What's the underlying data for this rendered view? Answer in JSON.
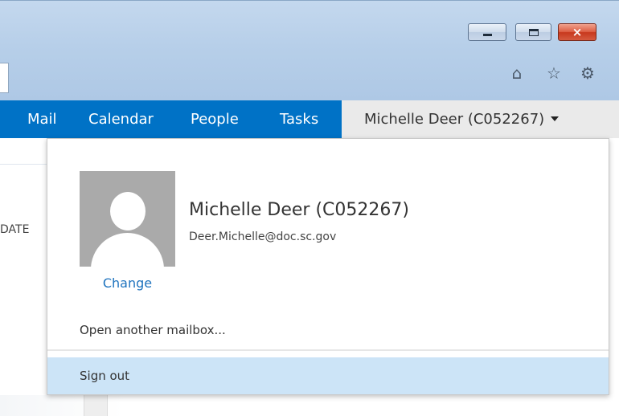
{
  "window": {
    "controls": {
      "minimize": "minimize",
      "maximize": "maximize",
      "close": "×"
    },
    "toolbar_icons": [
      "home-icon",
      "star-icon",
      "gear-icon"
    ]
  },
  "nav": {
    "items": [
      {
        "label": "Mail"
      },
      {
        "label": "Calendar"
      },
      {
        "label": "People"
      },
      {
        "label": "Tasks"
      }
    ],
    "user_tab": "Michelle Deer (C052267)"
  },
  "background": {
    "column_header": "DATE"
  },
  "account_menu": {
    "display_name": "Michelle Deer (C052267)",
    "email": "Deer.Michelle@doc.sc.gov",
    "change_photo": "Change",
    "open_other": "Open another mailbox...",
    "sign_out": "Sign out"
  },
  "colors": {
    "nav_blue": "#0072c6",
    "user_tab_bg": "#eaeaea",
    "link_blue": "#1e73be",
    "hover_row": "#cce4f7"
  }
}
